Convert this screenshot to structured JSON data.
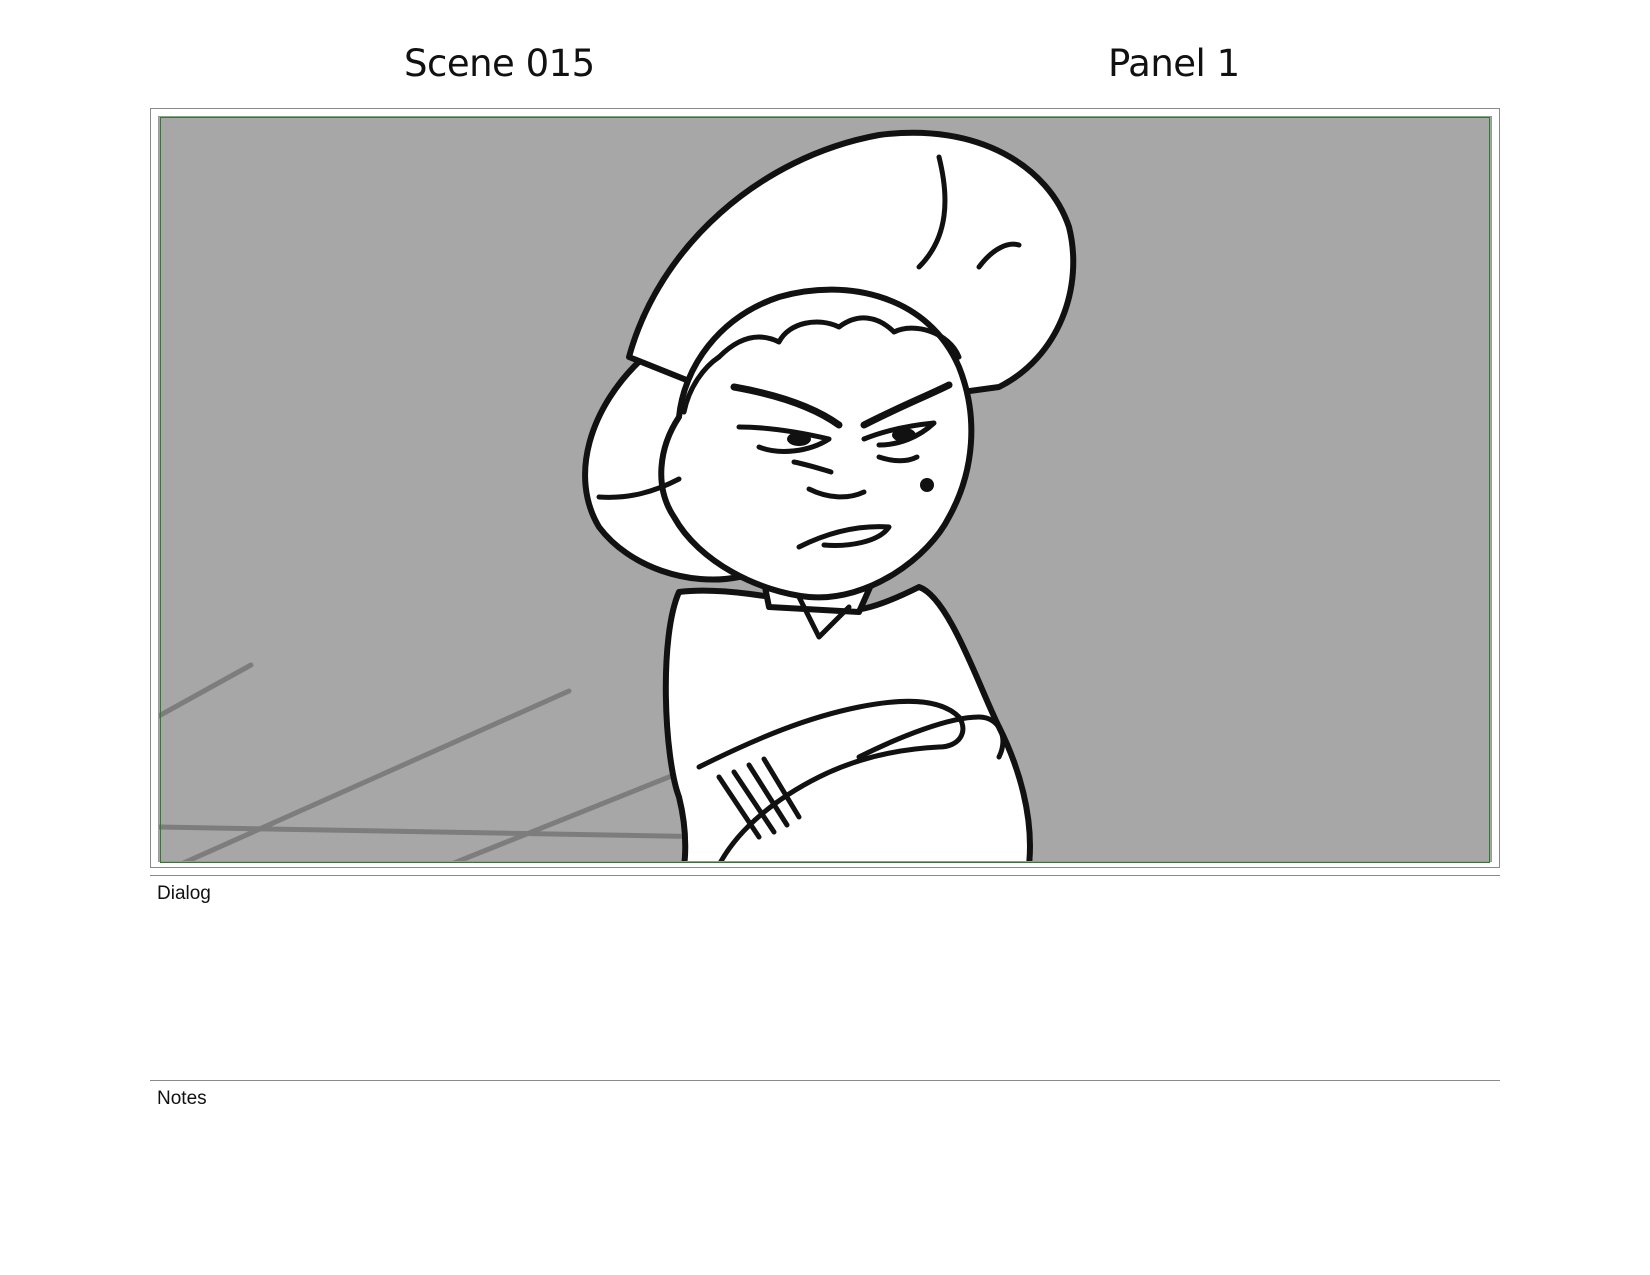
{
  "header": {
    "scene": "Scene 015",
    "panel": "Panel 1"
  },
  "drawing": {
    "description_icon": "storyboard-sketch",
    "background_color": "#a7a7a7",
    "safe_area_color": "#2e7d2e"
  },
  "dialog": {
    "label": "Dialog",
    "text": ""
  },
  "notes": {
    "label": "Notes",
    "text": ""
  }
}
